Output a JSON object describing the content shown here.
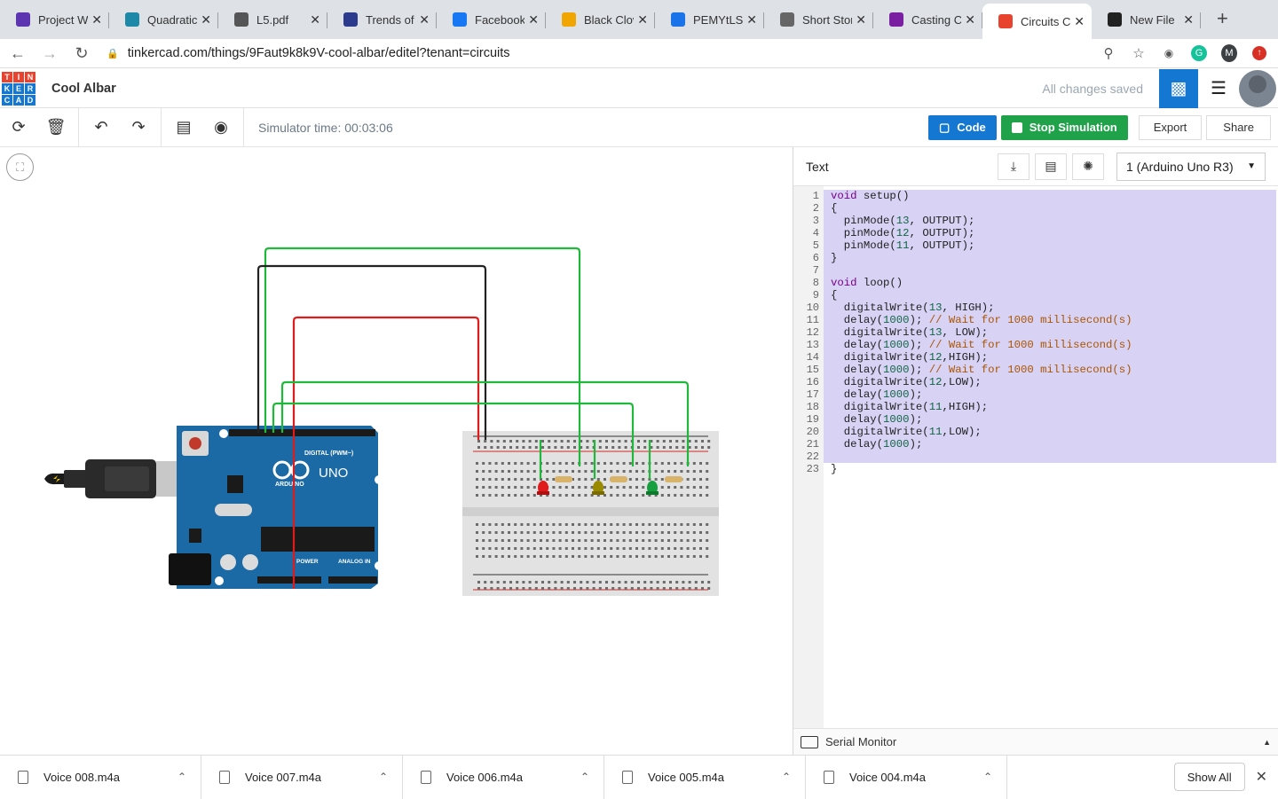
{
  "browser": {
    "tabs": [
      {
        "label": "Project We",
        "icon": "form-icon",
        "color": "#5e35b1"
      },
      {
        "label": "Quadratic",
        "icon": "globe-icon",
        "color": "#1e88a8"
      },
      {
        "label": "L5.pdf",
        "icon": "globe-icon",
        "color": "#555555"
      },
      {
        "label": "Trends of",
        "icon": "book-icon",
        "color": "#2b3a8c"
      },
      {
        "label": "Facebook",
        "icon": "facebook-icon",
        "color": "#1877f2"
      },
      {
        "label": "Black Clov",
        "icon": "crown-icon",
        "color": "#f0a500"
      },
      {
        "label": "PEMYtLSJ",
        "icon": "map-pin-icon",
        "color": "#1a73e8"
      },
      {
        "label": "Short Stor",
        "icon": "runner-icon",
        "color": "#666666"
      },
      {
        "label": "Casting C",
        "icon": "form-icon",
        "color": "#7b1fa2"
      },
      {
        "label": "Circuits C",
        "icon": "tinkercad-icon",
        "color": "#e8432e",
        "active": true
      },
      {
        "label": "New File",
        "icon": "github-icon",
        "color": "#222222"
      }
    ],
    "new_tab": "+",
    "url": "tinkercad.com/things/9Faut9k8k9V-cool-albar/editel?tenant=circuits",
    "profile_initial": "M"
  },
  "app": {
    "logo_letters": [
      "T",
      "I",
      "N",
      "K",
      "E",
      "R",
      "C",
      "A",
      "D"
    ],
    "logo_colors": [
      "#e8432e",
      "#e8432e",
      "#e8432e",
      "#1477d1",
      "#1477d1",
      "#1477d1",
      "#1477d1",
      "#1477d1",
      "#1477d1"
    ],
    "project_name": "Cool Albar",
    "save_status": "All changes saved",
    "simulator_time": "Simulator time: 00:03:06",
    "buttons": {
      "code": "Code",
      "stop": "Stop Simulation",
      "export": "Export",
      "share": "Share"
    }
  },
  "code_panel": {
    "mode": "Text",
    "board": "1 (Arduino Uno R3)",
    "serial_monitor": "Serial Monitor",
    "line_numbers": [
      "1",
      "2",
      "3",
      "4",
      "5",
      "6",
      "7",
      "8",
      "9",
      "10",
      "11",
      "12",
      "13",
      "14",
      "15",
      "16",
      "17",
      "18",
      "19",
      "20",
      "21",
      "22",
      "23"
    ],
    "lines": [
      "void setup()",
      "{",
      "  pinMode(13, OUTPUT);",
      "  pinMode(12, OUTPUT);",
      "  pinMode(11, OUTPUT);",
      "}",
      "",
      "void loop()",
      "{",
      "  digitalWrite(13, HIGH);",
      "  delay(1000); // Wait for 1000 millisecond(s)",
      "  digitalWrite(13, LOW);",
      "  delay(1000); // Wait for 1000 millisecond(s)",
      "  digitalWrite(12,HIGH);",
      "  delay(1000); // Wait for 1000 millisecond(s)",
      "  digitalWrite(12,LOW);",
      "  delay(1000);",
      "  digitalWrite(11,HIGH);",
      "  delay(1000);",
      "  digitalWrite(11,LOW);",
      "  delay(1000);",
      "",
      "}"
    ]
  },
  "board": {
    "brand": "ARDUINO",
    "model": "UNO",
    "digital": "DIGITAL (PWM~)",
    "power": "POWER",
    "analog": "ANALOG IN"
  },
  "downloads": [
    {
      "name": "Voice 008.m4a"
    },
    {
      "name": "Voice 007.m4a"
    },
    {
      "name": "Voice 006.m4a"
    },
    {
      "name": "Voice 005.m4a"
    },
    {
      "name": "Voice 004.m4a"
    }
  ],
  "show_all": "Show All"
}
